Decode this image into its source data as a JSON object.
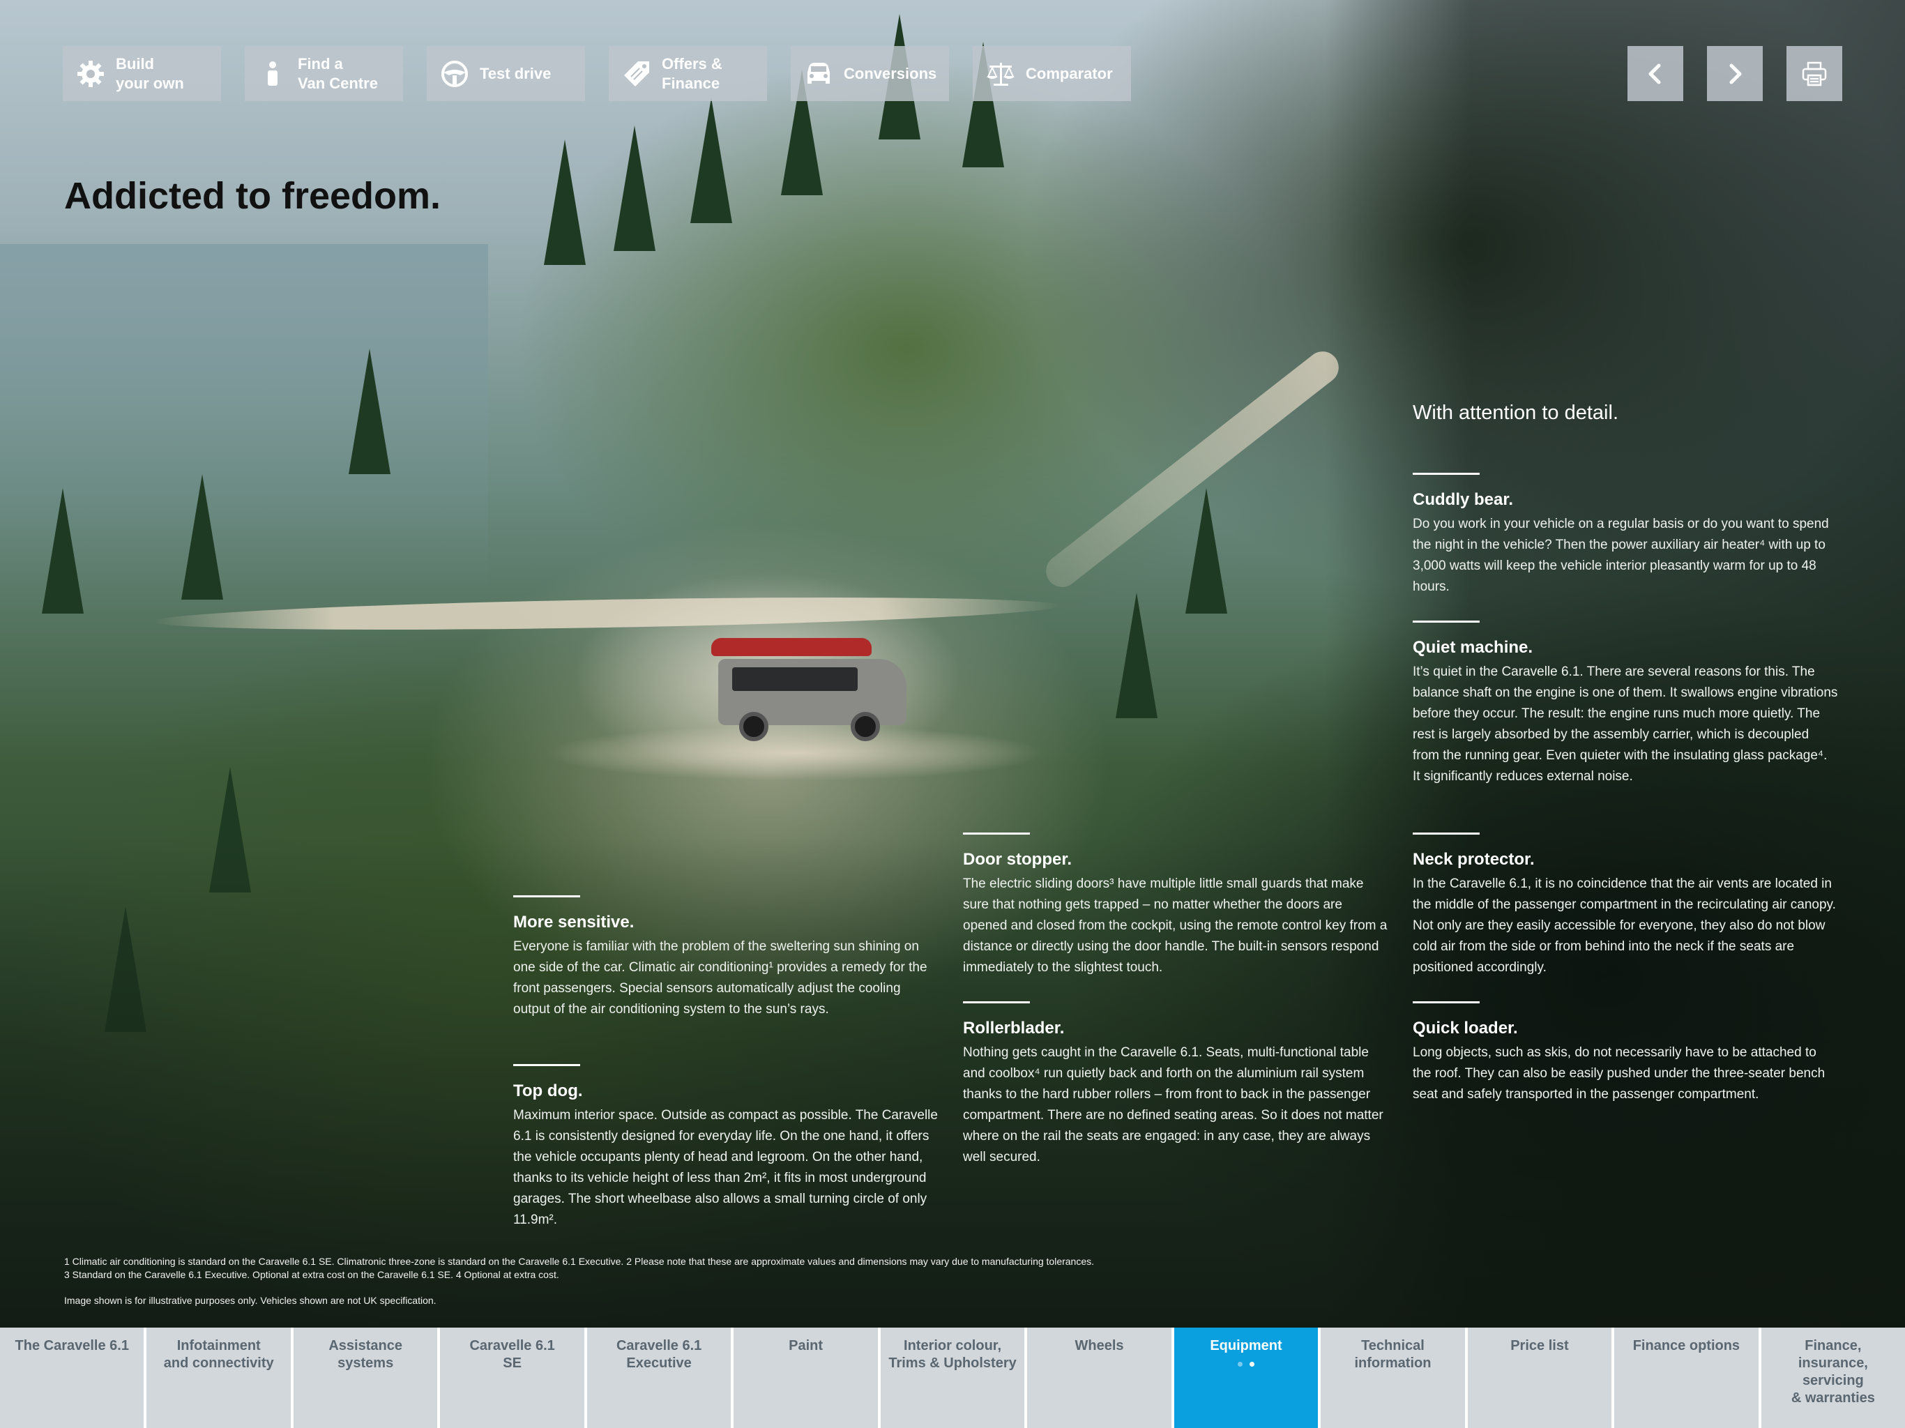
{
  "toolbar": {
    "items": [
      {
        "label": "Build\nyour own",
        "icon": "gear-icon"
      },
      {
        "label": "Find a\nVan Centre",
        "icon": "person-icon"
      },
      {
        "label": "Test drive",
        "icon": "steering-wheel-icon"
      },
      {
        "label": "Offers &\nFinance",
        "icon": "tag-icon"
      },
      {
        "label": "Conversions",
        "icon": "car-front-icon"
      },
      {
        "label": "Comparator",
        "icon": "scales-icon"
      }
    ],
    "nav": {
      "prev": "chevron-left-icon",
      "next": "chevron-right-icon",
      "print": "printer-icon"
    }
  },
  "headline": "Addicted to freedom.",
  "intro": "With attention to detail.",
  "features": {
    "more_sensitive": {
      "title": "More sensitive.",
      "body": "Everyone is familiar with the problem of the sweltering sun shining on one side of the car. Climatic air conditioning¹ provides a remedy for the front passengers. Special sensors automatically adjust the cooling output of the air conditioning system to the sun’s rays."
    },
    "top_dog": {
      "title": "Top dog.",
      "body": "Maximum interior space. Outside as compact as possible. The Caravelle 6.1 is consistently designed for everyday life. On the one hand, it offers the vehicle occupants plenty of head and legroom. On the other hand, thanks to its vehicle height of less than 2m², it fits in most underground garages. The short wheelbase also allows a small turning circle of only 11.9m²."
    },
    "door_stopper": {
      "title": "Door stopper.",
      "body": "The electric sliding doors³ have multiple little small guards that make sure that nothing gets trapped – no matter whether the doors are opened and closed from the cockpit, using the remote control key from a distance or directly using the door handle. The built-in sensors respond immediately to the slightest touch."
    },
    "rollerblader": {
      "title": "Rollerblader.",
      "body": "Nothing gets caught in the Caravelle 6.1. Seats, multi-functional table and coolbox⁴ run quietly back and forth on the aluminium rail system thanks to the hard rubber rollers – from front to back in the passenger compartment. There are no defined seating areas. So it does not matter where on the rail the seats are engaged: in any case, they are always well secured."
    },
    "cuddly_bear": {
      "title": "Cuddly bear.",
      "body": "Do you work in your vehicle on a regular basis or do you want to spend the night in the vehicle? Then the power auxiliary air heater⁴ with up to 3,000 watts will keep the vehicle interior pleasantly warm for up to 48 hours."
    },
    "quiet_machine": {
      "title": "Quiet machine.",
      "body": "It’s quiet in the Caravelle 6.1. There are several reasons for this. The balance shaft on the engine is one of them. It swallows engine vibrations before they occur. The result: the engine runs much more quietly. The rest is largely absorbed by the assembly carrier, which is decoupled from the running gear. Even quieter with the insulating glass package⁴. It significantly reduces external noise."
    },
    "neck_protector": {
      "title": "Neck protector.",
      "body": "In the Caravelle 6.1, it is no coincidence that the air vents are located in the middle of the passenger compartment in the recirculating air canopy. Not only are they easily accessible for everyone, they also do not blow cold air from the side or from behind into the neck if the seats are positioned accordingly."
    },
    "quick_loader": {
      "title": "Quick loader.",
      "body": "Long objects, such as skis, do not necessarily have to be attached to the roof. They can also be easily pushed under the three-seater bench seat and safely transported in the passenger compartment."
    }
  },
  "footnotes": {
    "line1": "1 Climatic air conditioning is standard on the Caravelle 6.1 SE. Climatronic three-zone is standard on the Caravelle 6.1 Executive.    2 Please note that these are approximate values and dimensions may vary due to manufacturing tolerances.",
    "line2": "3 Standard on the Caravelle 6.1 Executive. Optional at extra cost on the Caravelle 6.1 SE.    4 Optional at extra cost.",
    "disclaimer": "Image shown is for illustrative purposes only. Vehicles shown are not UK specification."
  },
  "tabs": [
    {
      "label": "The Caravelle 6.1"
    },
    {
      "label": "Infotainment\nand connectivity"
    },
    {
      "label": "Assistance\nsystems"
    },
    {
      "label": "Caravelle 6.1\nSE"
    },
    {
      "label": "Caravelle 6.1\nExecutive"
    },
    {
      "label": "Paint"
    },
    {
      "label": "Interior colour,\nTrims & Upholstery"
    },
    {
      "label": "Wheels"
    },
    {
      "label": "Equipment",
      "active": true
    },
    {
      "label": "Technical\ninformation"
    },
    {
      "label": "Price list"
    },
    {
      "label": "Finance options"
    },
    {
      "label": "Finance,\ninsurance,\nservicing\n& warranties"
    }
  ],
  "colors": {
    "active_tab": "#0aa0e0",
    "tab_bg": "#d2d7dc",
    "tab_text": "#5a6670"
  }
}
